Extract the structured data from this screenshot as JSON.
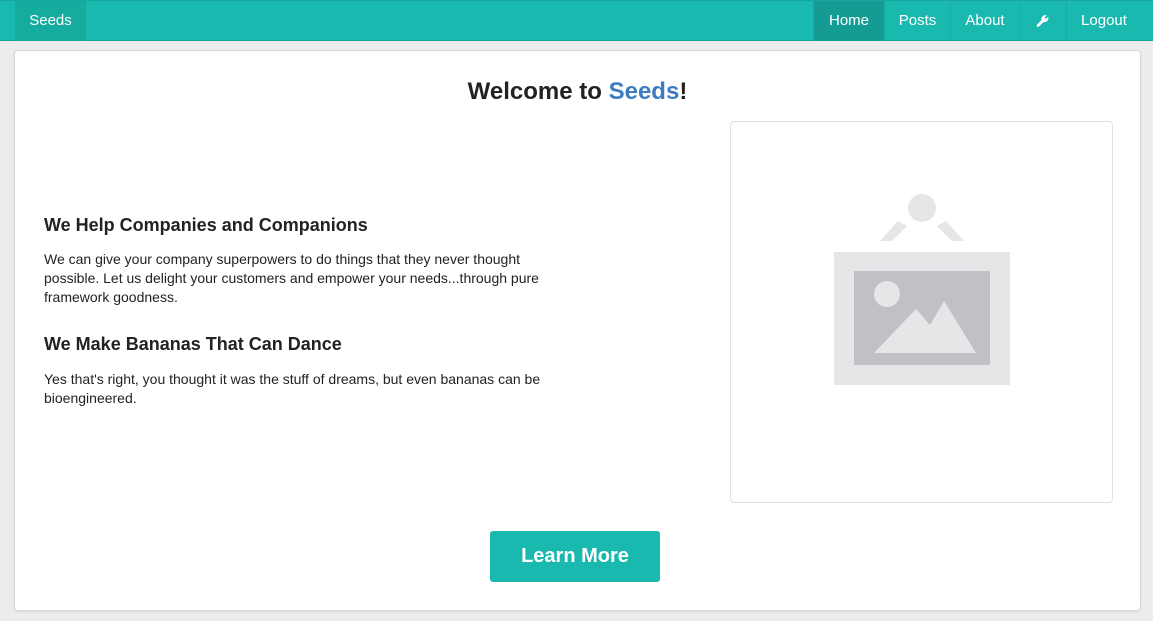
{
  "navbar": {
    "brand": "Seeds",
    "items": [
      {
        "label": "Home",
        "active": true
      },
      {
        "label": "Posts",
        "active": false
      },
      {
        "label": "About",
        "active": false
      },
      {
        "icon": "wrench-icon",
        "active": false
      },
      {
        "label": "Logout",
        "active": false
      }
    ]
  },
  "main": {
    "title_prefix": "Welcome to ",
    "title_brand": "Seeds",
    "title_suffix": "!",
    "sections": [
      {
        "heading": "We Help Companies and Companions",
        "text": "We can give your company superpowers to do things that they never thought possible. Let us delight your customers and empower your needs...through pure framework goodness."
      },
      {
        "heading": "We Make Bananas That Can Dance",
        "text": "Yes that's right, you thought it was the stuff of dreams, but even bananas can be bioengineered."
      }
    ],
    "image": {
      "icon": "image-placeholder-icon"
    },
    "cta_label": "Learn More"
  },
  "colors": {
    "navbar": "#1ab9b0",
    "nav_active": "#149b93",
    "brand_word": "#3d7cc1",
    "button": "#1ab9b0"
  }
}
